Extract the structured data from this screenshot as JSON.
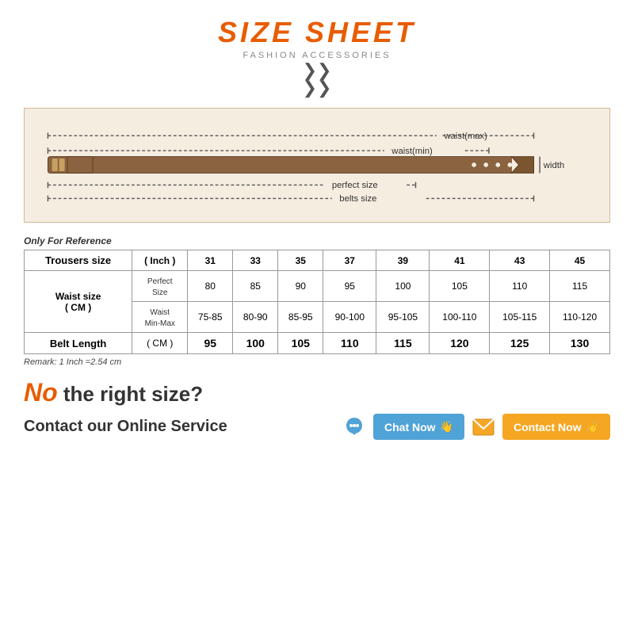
{
  "title": {
    "main": "SIZE SHEET",
    "sub": "FASHION ACCESSORIES"
  },
  "belt_diagram": {
    "waist_max_label": "waist(max)",
    "waist_min_label": "waist(min)",
    "width_label": "width",
    "perfect_size_label": "perfect size",
    "belts_size_label": "belts size"
  },
  "table": {
    "reference_text": "Only For Reference",
    "columns": {
      "trousers_size": "Trousers size",
      "inch": "( Inch )",
      "sizes": [
        "31",
        "33",
        "35",
        "37",
        "39",
        "41",
        "43",
        "45"
      ]
    },
    "waist_size_label": "Waist size",
    "waist_size_unit": "( CM )",
    "perfect_size": {
      "label": "Perfect Size",
      "values": [
        "80",
        "85",
        "90",
        "95",
        "100",
        "105",
        "110",
        "115"
      ]
    },
    "waist_min_max": {
      "label": "Waist Min-Max",
      "values": [
        "75-85",
        "80-90",
        "85-95",
        "90-100",
        "95-105",
        "100-110",
        "105-115",
        "110-120"
      ]
    },
    "belt_length": {
      "label": "Belt Length",
      "unit": "( CM )",
      "values": [
        "95",
        "100",
        "105",
        "110",
        "115",
        "120",
        "125",
        "130"
      ]
    },
    "remark": "Remark: 1 Inch =2.54 cm"
  },
  "bottom": {
    "no_text": "No",
    "right_size_text": " the right size?",
    "contact_label": "Contact our Online Service",
    "chat_btn": "Chat Now",
    "contact_btn": "Contact Now"
  }
}
